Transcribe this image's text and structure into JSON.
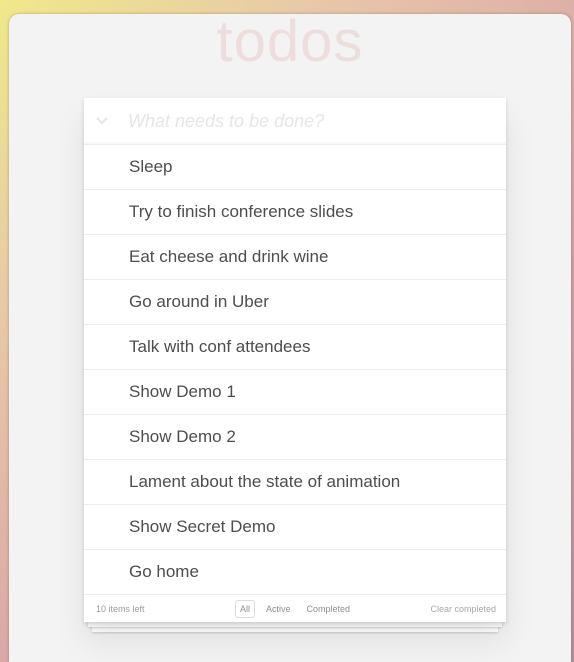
{
  "app": {
    "title": "todos"
  },
  "new_todo": {
    "placeholder": "What needs to be done?",
    "value": ""
  },
  "todos": [
    {
      "label": "Sleep"
    },
    {
      "label": "Try to finish conference slides"
    },
    {
      "label": "Eat cheese and drink wine"
    },
    {
      "label": "Go around in Uber"
    },
    {
      "label": "Talk with conf attendees"
    },
    {
      "label": "Show Demo 1"
    },
    {
      "label": "Show Demo 2"
    },
    {
      "label": "Lament about the state of animation"
    },
    {
      "label": "Show Secret Demo"
    },
    {
      "label": "Go home"
    }
  ],
  "footer": {
    "count_text": "10 items left",
    "filters": {
      "all": "All",
      "active": "Active",
      "completed": "Completed"
    },
    "selected_filter": "All",
    "clear_completed": "Clear completed"
  },
  "colors": {
    "title": "#e2b4b4",
    "border": "#ededed",
    "text": "#4d4d4d"
  },
  "icons": {
    "toggle_all": "chevron-down-icon"
  }
}
